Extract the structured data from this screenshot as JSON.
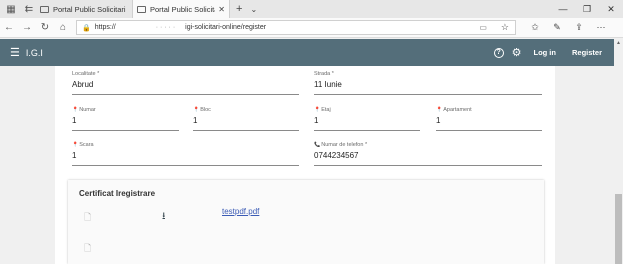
{
  "browser": {
    "tabs": [
      {
        "title": "Portal Public Solicitari Online",
        "active": false
      },
      {
        "title": "Portal Public Solicitari C",
        "active": true
      }
    ],
    "url": {
      "protocol": "https://",
      "path": "igi-solicitari-online/register"
    }
  },
  "header": {
    "brand": "I.G.I",
    "login": "Log in",
    "register": "Register"
  },
  "form": {
    "localitate": {
      "label": "Localitate *",
      "value": "Abrud"
    },
    "strada": {
      "label": "Strada *",
      "value": "11 Iunie"
    },
    "numar": {
      "label": "Numar",
      "value": "1"
    },
    "bloc": {
      "label": "Bloc",
      "value": "1"
    },
    "etaj": {
      "label": "Etaj",
      "value": "1"
    },
    "apartament": {
      "label": "Apartament",
      "value": "1"
    },
    "scara": {
      "label": "Scara",
      "value": "1"
    },
    "telefon": {
      "label": "Numar de telefon *",
      "value": "0744234567"
    }
  },
  "certificate": {
    "title": "Certificat Iregistrare",
    "file_name": "testpdf.pdf"
  }
}
